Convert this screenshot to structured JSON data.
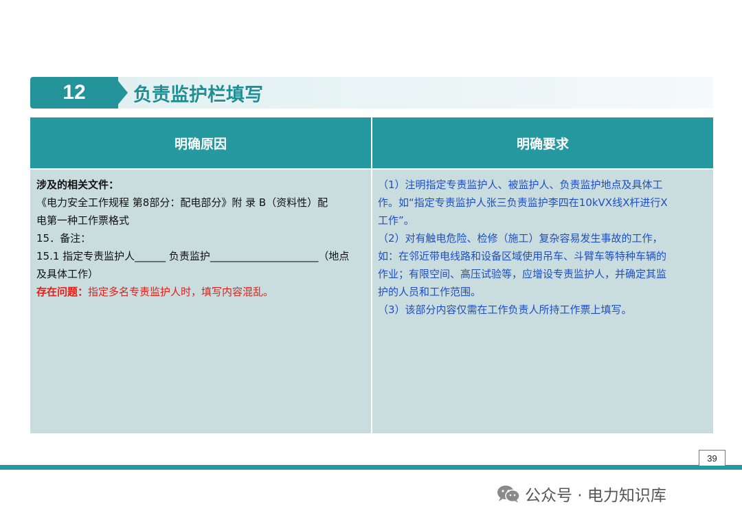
{
  "header": {
    "number": "12",
    "title": "负责监护栏填写"
  },
  "table": {
    "col_left_header": "明确原因",
    "col_right_header": "明确要求",
    "left": {
      "heading": "涉及的相关文件：",
      "lines": [
        "《电力安全工作规程  第8部分：配电部分》附 录 B（资料性）配",
        "电第一种工作票格式",
        "15．备注：",
        "15.1 指定专责监护人______ 负责监护_____________________（地点",
        "及具体工作）"
      ],
      "problem_label": "存在问题：",
      "problem_text": "指定多名专责监护人时，填写内容混乱。"
    },
    "right": {
      "lines": [
        "（1）注明指定专责监护人、被监护人、负责监护地点及具体工",
        "作。如“指定专责监护人张三负责监护李四在10kVX线X杆进行X",
        "工作”。",
        "（2）对有触电危险、检修（施工）复杂容易发生事故的工作，",
        "如：在邻近带电线路和设备区域使用吊车、斗臂车等特种车辆的",
        "作业；有限空间、高压试验等，应增设专责监护人，并确定其监",
        "护的人员和工作范围。",
        "（3）该部分内容仅需在工作负责人所持工作票上填写。"
      ]
    }
  },
  "footer": {
    "page_number": "39",
    "watermark": "公众号 · 电力知识库"
  },
  "colors": {
    "teal": "#25999f",
    "cell_bg": "#c9dcde",
    "right_text": "#1f4fc4",
    "problem_red": "#e0201a"
  },
  "icons": [
    "wechat-icon"
  ]
}
